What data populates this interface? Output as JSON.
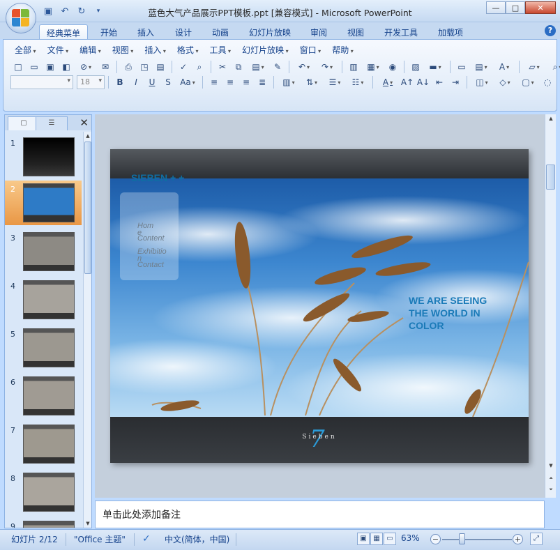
{
  "window": {
    "title": "蓝色大气产品展示PPT模板.ppt [兼容模式] - Microsoft PowerPoint",
    "controls": [
      "minimize",
      "maximize",
      "close"
    ]
  },
  "quick_access": [
    "save-icon",
    "undo-icon",
    "redo-icon",
    "customize-qat-icon"
  ],
  "ribbon": {
    "tabs": [
      {
        "label": "经典菜单",
        "active": true
      },
      {
        "label": "开始"
      },
      {
        "label": "插入"
      },
      {
        "label": "设计"
      },
      {
        "label": "动画"
      },
      {
        "label": "幻灯片放映"
      },
      {
        "label": "审阅"
      },
      {
        "label": "视图"
      },
      {
        "label": "开发工具"
      },
      {
        "label": "加载项"
      }
    ],
    "menus": [
      "全部",
      "文件",
      "编辑",
      "视图",
      "插入",
      "格式",
      "工具",
      "幻灯片放映",
      "窗口",
      "帮助"
    ],
    "font_size": "18"
  },
  "panel": {
    "tabs": [
      "slides-tab",
      "outline-tab"
    ],
    "slides": [
      {
        "num": "1"
      },
      {
        "num": "2",
        "selected": true
      },
      {
        "num": "3"
      },
      {
        "num": "4"
      },
      {
        "num": "5"
      },
      {
        "num": "6"
      },
      {
        "num": "7"
      },
      {
        "num": "8"
      },
      {
        "num": "9"
      }
    ]
  },
  "slide": {
    "brand": "SIEBEN + +",
    "nav": [
      "Hom",
      "e",
      "Content",
      "Exhibitio",
      "n",
      "Contact"
    ],
    "tagline": "WE ARE SEEING THE WORLD IN COLOR",
    "footer_brand": "Sieben",
    "footer_num": "7"
  },
  "notes": {
    "placeholder": "单击此处添加备注"
  },
  "status": {
    "slide_counter": "幻灯片 2/12",
    "theme": "\"Office 主题\"",
    "language": "中文(简体，中国)",
    "zoom": "63%"
  },
  "colors": {
    "accent": "#1e395b",
    "selection": "#e99745",
    "brand_blue": "#0f6ea3"
  }
}
